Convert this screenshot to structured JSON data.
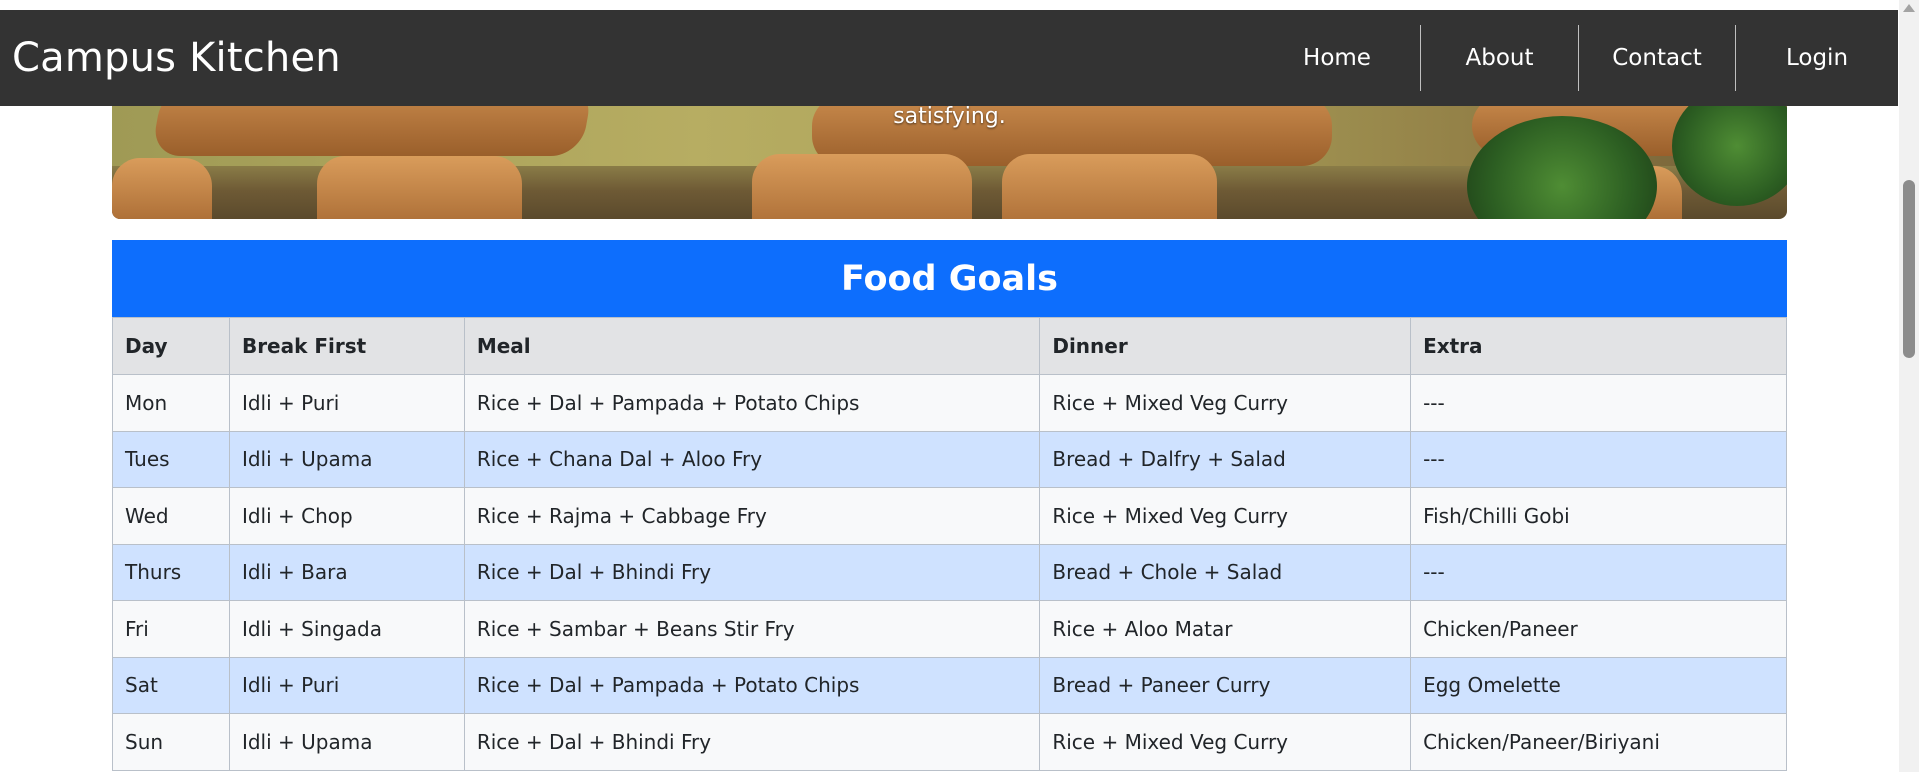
{
  "header": {
    "brand": "Campus Kitchen",
    "nav": [
      {
        "label": "Home"
      },
      {
        "label": "About"
      },
      {
        "label": "Contact"
      },
      {
        "label": "Login"
      }
    ]
  },
  "hero": {
    "caption": "satisfying."
  },
  "menu_card": {
    "title": "Food Goals",
    "columns": [
      "Day",
      "Break First",
      "Meal",
      "Dinner",
      "Extra"
    ],
    "rows": [
      [
        "Mon",
        "Idli + Puri",
        "Rice + Dal + Pampada + Potato Chips",
        "Rice + Mixed Veg Curry",
        "---"
      ],
      [
        "Tues",
        "Idli + Upama",
        "Rice + Chana Dal + Aloo Fry",
        "Bread + Dalfry + Salad",
        "---"
      ],
      [
        "Wed",
        "Idli + Chop",
        "Rice + Rajma + Cabbage Fry",
        "Rice + Mixed Veg Curry",
        "Fish/Chilli Gobi"
      ],
      [
        "Thurs",
        "Idli + Bara",
        "Rice + Dal + Bhindi Fry",
        "Bread + Chole + Salad",
        "---"
      ],
      [
        "Fri",
        "Idli + Singada",
        "Rice + Sambar + Beans Stir Fry",
        "Rice + Aloo Matar",
        "Chicken/Paneer"
      ],
      [
        "Sat",
        "Idli + Puri",
        "Rice + Dal + Pampada + Potato Chips",
        "Bread + Paneer Curry",
        "Egg Omelette"
      ],
      [
        "Sun",
        "Idli + Upama",
        "Rice + Dal + Bhindi Fry",
        "Rice + Mixed Veg Curry",
        "Chicken/Paneer/Biriyani"
      ]
    ]
  },
  "colors": {
    "navbar_bg": "#333333",
    "card_header_bg": "#0d6efd",
    "row_striped_light": "#f8f9fa",
    "row_striped_blue": "#cfe2ff",
    "table_head_bg": "#e2e3e5"
  }
}
